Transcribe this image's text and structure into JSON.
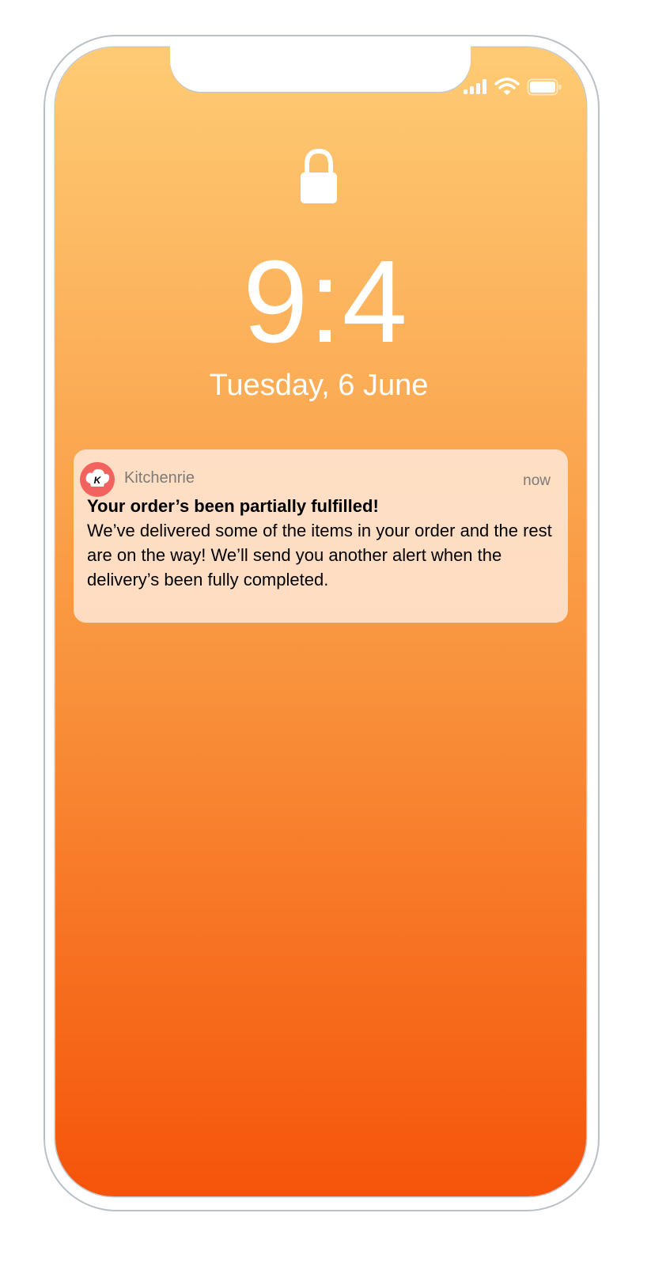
{
  "lock_screen": {
    "time": "9:4",
    "date": "Tuesday, 6 June",
    "wallpaper_top_color": "#fecb74",
    "wallpaper_bottom_color": "#f5540a"
  },
  "status_bar": {
    "icons": [
      "cellular-signal-icon",
      "wifi-icon",
      "battery-icon"
    ]
  },
  "notification": {
    "app_name": "Kitchenrie",
    "app_icon": "chef-hat-icon",
    "app_icon_letter": "K",
    "app_icon_color": "#f2635f",
    "timestamp": "now",
    "title": "Your order’s been partially fulfilled!",
    "body": "We’ve delivered some of the items in your order and the rest are on the way! We’ll send you another alert when the delivery’s been fully completed."
  }
}
